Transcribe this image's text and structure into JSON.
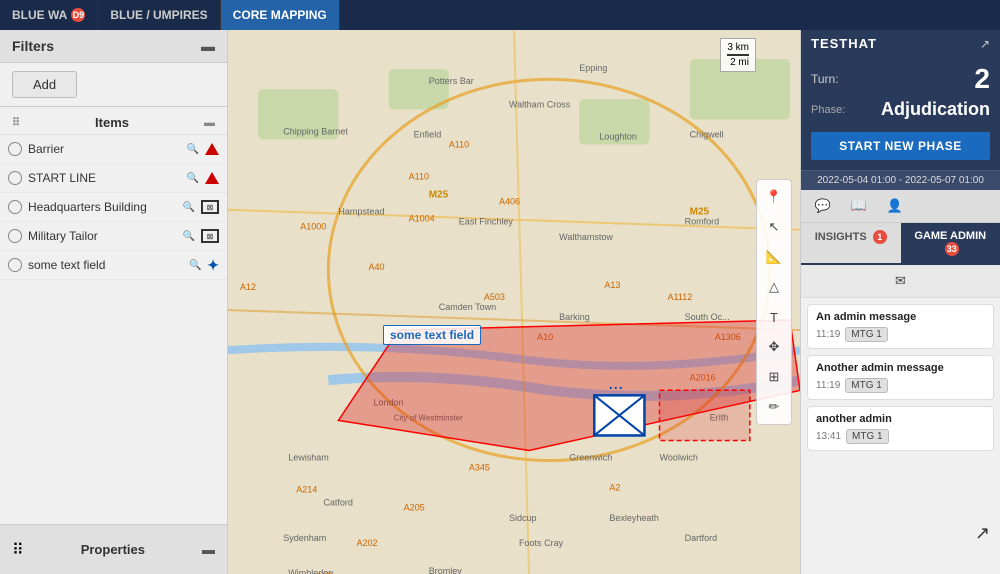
{
  "nav": {
    "tabs": [
      {
        "id": "blue-wa",
        "label": "BLUE WA",
        "badge": "D9",
        "active": false
      },
      {
        "id": "blue-umpires",
        "label": "BLUE / UMPIRES",
        "active": false
      },
      {
        "id": "core-mapping",
        "label": "CORE MAPPING",
        "active": true
      }
    ]
  },
  "sidebar": {
    "filters_label": "Filters",
    "add_label": "Add",
    "items_label": "Items",
    "properties_label": "Properties",
    "items": [
      {
        "name": "Barrier",
        "icon_type": "triangle_red"
      },
      {
        "name": "START LINE",
        "icon_type": "triangle_red"
      },
      {
        "name": "Headquarters Building",
        "icon_type": "unit_box"
      },
      {
        "name": "Military Tailor",
        "icon_type": "unit_box"
      },
      {
        "name": "some text field",
        "icon_type": "blue_cross"
      }
    ]
  },
  "right_panel": {
    "title": "TESTHAT",
    "turn_label": "Turn:",
    "turn_number": "2",
    "phase_label": "Phase:",
    "phase_value": "Adjudication",
    "start_new_phase_label": "START NEW PHASE",
    "date_range": "2022-05-04 01:00 - 2022-05-07 01:00",
    "tab_insights": "INSIGHTS",
    "tab_insights_badge": "1",
    "tab_game_admin": "GAME ADMIN",
    "tab_game_admin_badge": "33",
    "messages": [
      {
        "title": "An admin message",
        "time": "11:19",
        "tag": "MTG 1"
      },
      {
        "title": "Another admin message",
        "time": "11:19",
        "tag": "MTG 1"
      },
      {
        "title": "another admin",
        "time": "13:41",
        "tag": "MTG 1"
      }
    ]
  },
  "map": {
    "scale_3km": "3 km",
    "scale_2mi": "2 mi",
    "text_field_label": "some text field",
    "tools": [
      "location-pin",
      "cursor",
      "measure",
      "draw-polygon",
      "text",
      "move",
      "zoom-fit",
      "edit"
    ]
  }
}
